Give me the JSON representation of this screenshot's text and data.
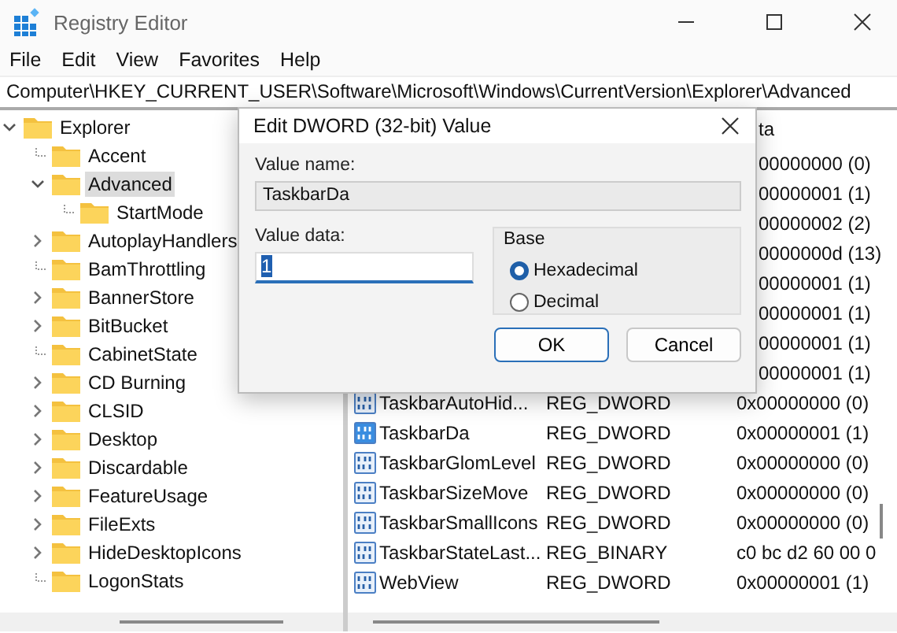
{
  "window": {
    "title": "Registry Editor"
  },
  "menu": [
    "File",
    "Edit",
    "View",
    "Favorites",
    "Help"
  ],
  "address": "Computer\\HKEY_CURRENT_USER\\Software\\Microsoft\\Windows\\CurrentVersion\\Explorer\\Advanced",
  "tree": [
    {
      "label": "Explorer",
      "kind": "branch",
      "expanded": true,
      "selected": false,
      "children": [
        {
          "label": "Accent",
          "kind": "leaf",
          "selected": false
        },
        {
          "label": "Advanced",
          "kind": "branch",
          "expanded": true,
          "selected": true,
          "children": [
            {
              "label": "StartMode",
              "kind": "leaf",
              "selected": false
            }
          ]
        },
        {
          "label": "AutoplayHandlers",
          "kind": "branch",
          "expanded": false,
          "selected": false
        },
        {
          "label": "BamThrottling",
          "kind": "leaf",
          "selected": false
        },
        {
          "label": "BannerStore",
          "kind": "branch",
          "expanded": false,
          "selected": false
        },
        {
          "label": "BitBucket",
          "kind": "branch",
          "expanded": false,
          "selected": false
        },
        {
          "label": "CabinetState",
          "kind": "leaf",
          "selected": false
        },
        {
          "label": "CD Burning",
          "kind": "branch",
          "expanded": false,
          "selected": false
        },
        {
          "label": "CLSID",
          "kind": "branch",
          "expanded": false,
          "selected": false
        },
        {
          "label": "Desktop",
          "kind": "branch",
          "expanded": false,
          "selected": false
        },
        {
          "label": "Discardable",
          "kind": "branch",
          "expanded": false,
          "selected": false
        },
        {
          "label": "FeatureUsage",
          "kind": "branch",
          "expanded": false,
          "selected": false
        },
        {
          "label": "FileExts",
          "kind": "branch",
          "expanded": false,
          "selected": false
        },
        {
          "label": "HideDesktopIcons",
          "kind": "branch",
          "expanded": false,
          "selected": false
        },
        {
          "label": "LogonStats",
          "kind": "leaf",
          "selected": false
        }
      ]
    }
  ],
  "values": {
    "column_3": "ta",
    "rows": [
      {
        "data": "00000000 (0)"
      },
      {
        "data": "00000001 (1)"
      },
      {
        "data": "00000002 (2)"
      },
      {
        "data": "0000000d (13)"
      },
      {
        "data": "00000001 (1)"
      },
      {
        "data": "00000001 (1)"
      },
      {
        "data": "00000001 (1)"
      },
      {
        "data": "00000001 (1)"
      },
      {
        "name": "TaskbarAutoHid...",
        "type": "REG_DWORD",
        "data": "0x00000000 (0)",
        "selected": false
      },
      {
        "name": "TaskbarDa",
        "type": "REG_DWORD",
        "data": "0x00000001 (1)",
        "selected": true
      },
      {
        "name": "TaskbarGlomLevel",
        "type": "REG_DWORD",
        "data": "0x00000000 (0)",
        "selected": false
      },
      {
        "name": "TaskbarSizeMove",
        "type": "REG_DWORD",
        "data": "0x00000000 (0)",
        "selected": false
      },
      {
        "name": "TaskbarSmallIcons",
        "type": "REG_DWORD",
        "data": "0x00000000 (0)",
        "selected": false
      },
      {
        "name": "TaskbarStateLast...",
        "type": "REG_BINARY",
        "data": "c0 bc d2 60 00 0",
        "selected": false
      },
      {
        "name": "WebView",
        "type": "REG_DWORD",
        "data": "0x00000001 (1)",
        "selected": false
      }
    ]
  },
  "dialog": {
    "title": "Edit DWORD (32-bit) Value",
    "name_label": "Value name:",
    "name_value": "TaskbarDa",
    "data_label": "Value data:",
    "data_value": "1",
    "base_label": "Base",
    "bases": [
      {
        "label": "Hexadecimal",
        "selected": true
      },
      {
        "label": "Decimal",
        "selected": false
      }
    ],
    "buttons": [
      {
        "label": "OK",
        "default": true
      },
      {
        "label": "Cancel",
        "default": false
      }
    ]
  }
}
